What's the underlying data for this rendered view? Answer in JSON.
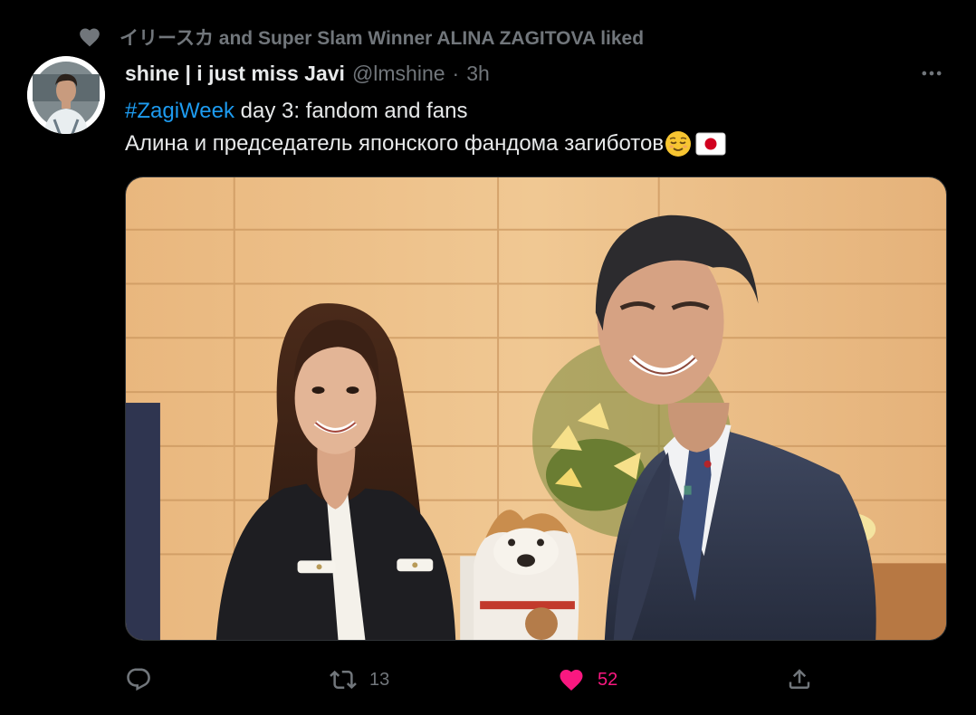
{
  "social_context": {
    "text": "イリースカ and Super Slam Winner ALINA ZAGITOVA liked",
    "icon": "heart-icon"
  },
  "tweet": {
    "display_name": "shine | i just miss Javi",
    "handle": "@lmshine",
    "separator": "·",
    "time": "3h",
    "hashtag": "#ZagiWeek",
    "text_line1_rest": " day 3: fandom and fans",
    "text_line2": "Алина и председатель японского фандома загиботов",
    "emojis": [
      "relieved-face-emoji",
      "japan-flag-emoji"
    ]
  },
  "actions": {
    "reply": {
      "icon": "reply-icon",
      "count": ""
    },
    "retweet": {
      "icon": "retweet-icon",
      "count": "13"
    },
    "like": {
      "icon": "heart-filled-icon",
      "count": "52",
      "liked": true,
      "color": "#f91880"
    },
    "share": {
      "icon": "share-icon",
      "count": ""
    }
  },
  "colors": {
    "background": "#000000",
    "text": "#e7e9ea",
    "secondary": "#71767b",
    "link": "#1d9bf0",
    "like": "#f91880"
  }
}
